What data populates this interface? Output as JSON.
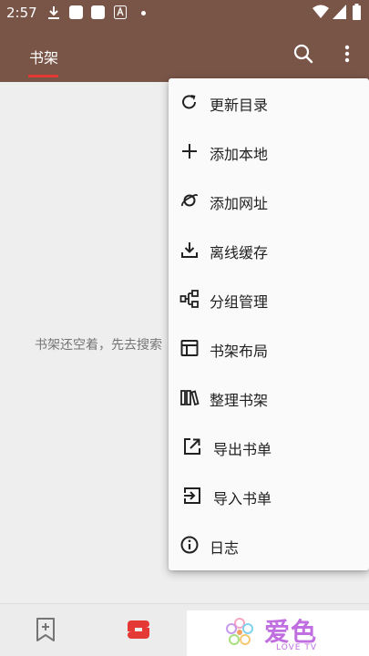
{
  "statusbar": {
    "time": "2:57"
  },
  "appbar": {
    "tab_title": "书架",
    "accent": "#795548",
    "indicator": "#e53935"
  },
  "content": {
    "empty_text": "书架还空着，先去搜索"
  },
  "menu": {
    "items": [
      {
        "label": "更新目录",
        "icon": "refresh-icon"
      },
      {
        "label": "添加本地",
        "icon": "plus-icon"
      },
      {
        "label": "添加网址",
        "icon": "planet-icon"
      },
      {
        "label": "离线缓存",
        "icon": "download-icon"
      },
      {
        "label": "分组管理",
        "icon": "group-icon"
      },
      {
        "label": "书架布局",
        "icon": "layout-icon"
      },
      {
        "label": "整理书架",
        "icon": "books-icon"
      },
      {
        "label": "导出书单",
        "icon": "export-icon"
      },
      {
        "label": "导入书单",
        "icon": "import-icon"
      },
      {
        "label": "日志",
        "icon": "info-icon"
      }
    ]
  },
  "watermark": {
    "title": "爱色",
    "subtitle": "LOVE TV"
  }
}
